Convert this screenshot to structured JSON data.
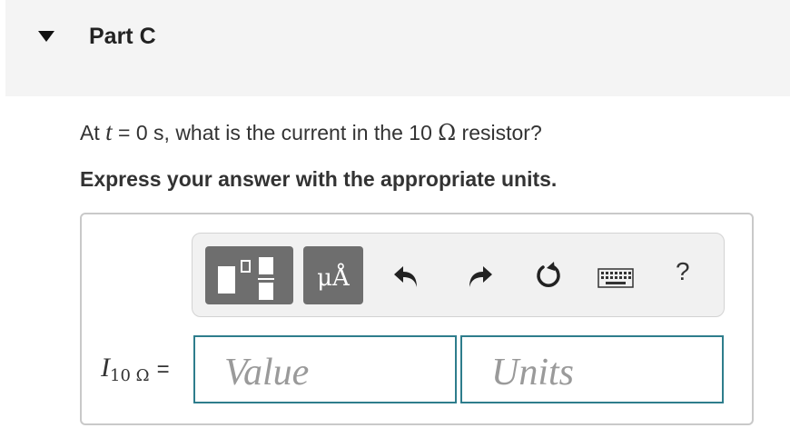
{
  "header": {
    "title": "Part C"
  },
  "question": {
    "prefix": "At ",
    "variable": "t",
    "middle": " = 0 s, what is the current in the 10 ",
    "unit_symbol": "Ω",
    "suffix": " resistor?"
  },
  "instruction": "Express your answer with the appropriate units.",
  "toolbar": {
    "templates_icon": "templates-icon",
    "units_label": "μÅ",
    "undo_icon": "undo-icon",
    "redo_icon": "redo-icon",
    "reset_icon": "reset-icon",
    "keyboard_icon": "keyboard-icon",
    "help_label": "?"
  },
  "answer": {
    "label_var": "I",
    "label_sub": "10 Ω",
    "equals": "=",
    "value_placeholder": "Value",
    "units_placeholder": "Units"
  },
  "colors": {
    "header_bg": "#f4f4f4",
    "toolbar_bg": "#f1f1f1",
    "button_bg": "#6e6e6e",
    "input_border": "#2e7d8c"
  }
}
